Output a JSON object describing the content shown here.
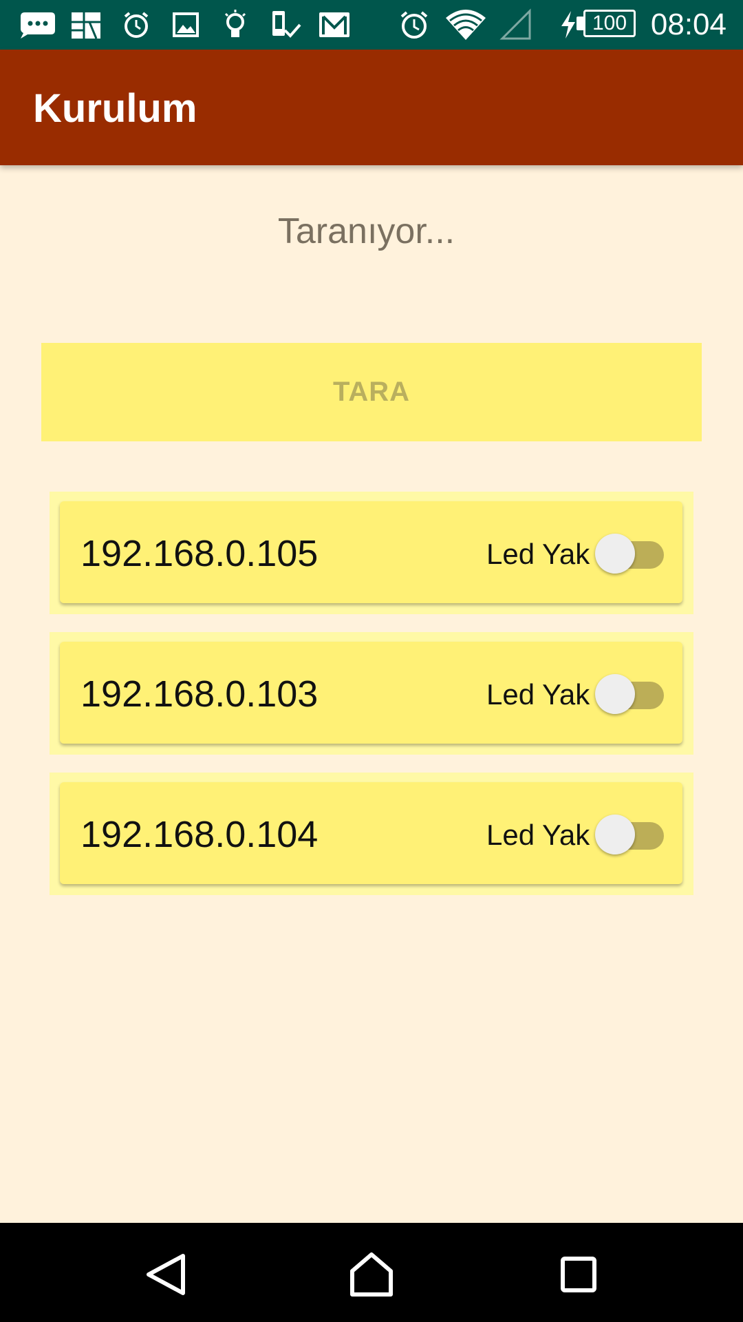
{
  "status_bar": {
    "battery": "100",
    "time": "08:04",
    "icons": [
      "chat-icon",
      "photo-collage-icon",
      "alarm-icon",
      "image-icon",
      "lightbulb-icon",
      "device-check-icon",
      "mail-icon",
      "alarm-clock-icon",
      "wifi-icon",
      "signal-icon",
      "charging-icon",
      "battery-icon"
    ]
  },
  "app_bar": {
    "title": "Kurulum"
  },
  "scan": {
    "status": "Taranıyor...",
    "button_label": "TARA"
  },
  "devices": [
    {
      "ip": "192.168.0.105",
      "switch_label": "Led Yak",
      "switch_on": false
    },
    {
      "ip": "192.168.0.103",
      "switch_label": "Led Yak",
      "switch_on": false
    },
    {
      "ip": "192.168.0.104",
      "switch_label": "Led Yak",
      "switch_on": false
    }
  ],
  "nav_bar": {
    "icons": [
      "back-icon",
      "home-icon",
      "recents-icon"
    ]
  },
  "colors": {
    "status_bar": "#00564C",
    "app_bar": "#992C00",
    "background": "#FFF2DC",
    "card": "#FFF176",
    "switch_track": "#BCAE57"
  }
}
